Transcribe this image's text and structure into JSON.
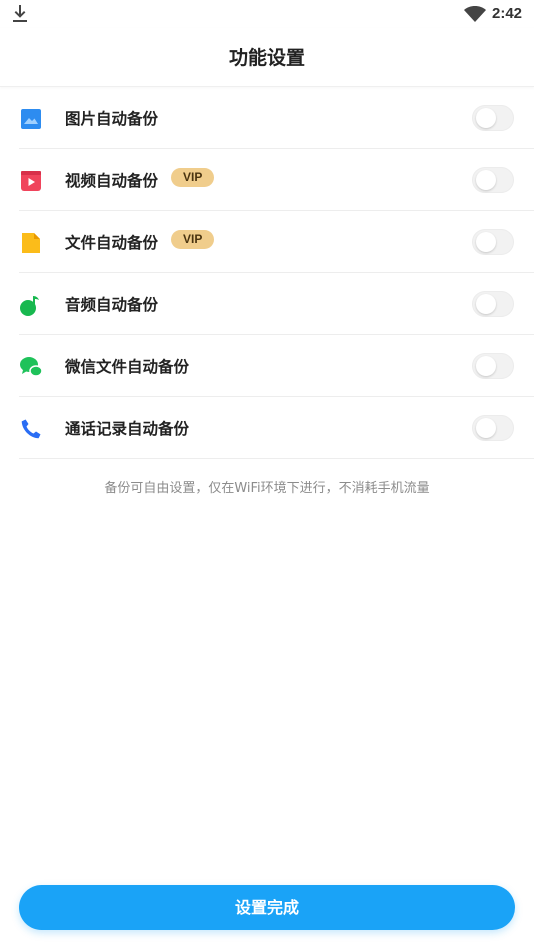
{
  "status_bar": {
    "time": "2:42",
    "icons": [
      "download-icon",
      "wifi-icon"
    ]
  },
  "header": {
    "title": "功能设置"
  },
  "settings": {
    "items": [
      {
        "label": "图片自动备份",
        "icon": "image-icon",
        "icon_color": "#2d8cf0",
        "vip": "",
        "enabled": false
      },
      {
        "label": "视频自动备份",
        "icon": "video-icon",
        "icon_color": "#f0445c",
        "vip": "VIP",
        "enabled": false
      },
      {
        "label": "文件自动备份",
        "icon": "file-icon",
        "icon_color": "#fbbc1a",
        "vip": "VIP",
        "enabled": false
      },
      {
        "label": "音频自动备份",
        "icon": "music-icon",
        "icon_color": "#18b84f",
        "vip": "",
        "enabled": false
      },
      {
        "label": "微信文件自动备份",
        "icon": "wechat-icon",
        "icon_color": "#1fc25a",
        "vip": "",
        "enabled": false
      },
      {
        "label": "通话记录自动备份",
        "icon": "phone-icon",
        "icon_color": "#2a6df4",
        "vip": "",
        "enabled": false
      }
    ]
  },
  "footer": {
    "note": "备份可自由设置，仅在WiFi环境下进行，不消耗手机流量",
    "done_label": "设置完成"
  },
  "colors": {
    "accent": "#1aa3f7",
    "vip_badge": "#f0cd8c",
    "toggle_off": "#f2f2f2"
  }
}
